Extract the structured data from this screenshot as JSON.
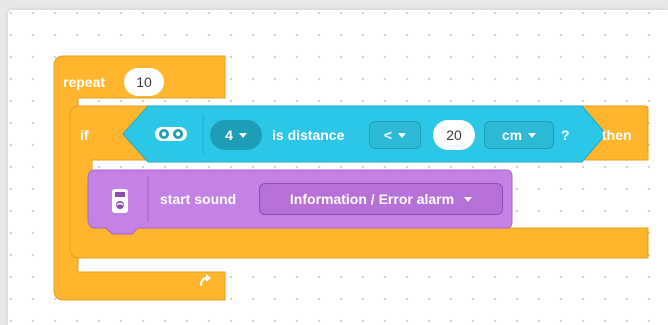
{
  "blocks": {
    "repeat": {
      "label": "repeat",
      "times": "10",
      "loop_icon": "loop-arrow-icon",
      "color": "#ffb52e"
    },
    "if_block": {
      "if_label": "if",
      "then_label": "then",
      "color": "#ffb52e"
    },
    "condition": {
      "sensor_icon": "distance-sensor-icon",
      "port": "4",
      "label": "is distance",
      "operator": "<",
      "value": "20",
      "unit": "cm",
      "question": "?",
      "color": "#2cc7e6"
    },
    "start_sound": {
      "icon": "hub-speaker-icon",
      "label": "start sound",
      "sound": "Information / Error alarm",
      "color": "#c481e6"
    }
  }
}
